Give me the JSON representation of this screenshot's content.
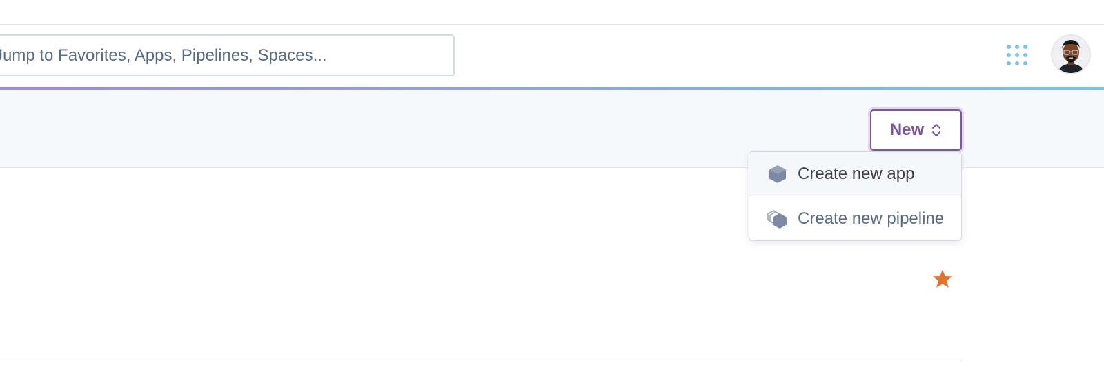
{
  "search": {
    "placeholder": "Jump to Favorites, Apps, Pipelines, Spaces..."
  },
  "header": {
    "apps_icon": "apps-grid-icon",
    "avatar_icon": "user-avatar"
  },
  "toolbar": {
    "new_label": "New",
    "new_icon": "chevron-up-down-icon"
  },
  "new_menu": {
    "items": [
      {
        "label": "Create new app",
        "icon": "hexagon-app-icon"
      },
      {
        "label": "Create new pipeline",
        "icon": "stacked-hexagons-pipeline-icon"
      }
    ]
  },
  "favorites": {
    "star_icon": "star-icon"
  },
  "colors": {
    "accent": "#79589f",
    "search_text": "#596b85",
    "apps_grid": "#79c3e6",
    "star": "#e5722c",
    "gradient_start": "#9b8cd0",
    "gradient_end": "#79c3e6"
  }
}
